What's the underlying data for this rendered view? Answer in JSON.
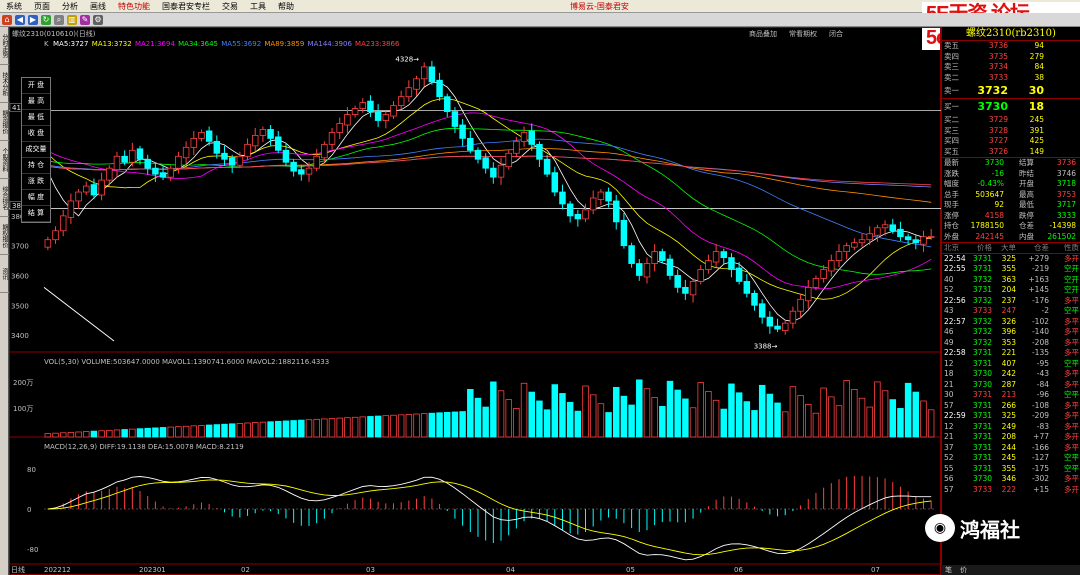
{
  "menubar": {
    "items": [
      "系统",
      "页面",
      "分析",
      "画线",
      "特色功能",
      "国泰君安专栏",
      "交易",
      "工具",
      "帮助"
    ],
    "active_index": 4,
    "window_title": "博易云-国泰君安"
  },
  "watermark": "5E天资 论坛 5etz.com",
  "left_tabs": [
    "分时走势",
    "技术分析",
    "期货报价",
    "个股资料",
    "综合排名",
    "期权报价",
    "资讯"
  ],
  "chart": {
    "title": "螺纹2310(010610)(日线)",
    "toplinks": [
      "商品叠加",
      "常看期权",
      "闭合"
    ],
    "ma_label_prefix": "K",
    "ma": [
      {
        "label": "MA5:3727",
        "color": "#ffffff"
      },
      {
        "label": "MA13:3732",
        "color": "#ffff00"
      },
      {
        "label": "MA21:3694",
        "color": "#ff00ff"
      },
      {
        "label": "MA34:3645",
        "color": "#00ff00"
      },
      {
        "label": "MA55:3692",
        "color": "#4080ff"
      },
      {
        "label": "MA89:3859",
        "color": "#ff8c00"
      },
      {
        "label": "MA144:3906",
        "color": "#8080ff"
      },
      {
        "label": "MA233:3866",
        "color": "#ff4040"
      }
    ],
    "price_axis": [
      "3800",
      "3700",
      "3600",
      "3500",
      "3400"
    ],
    "hline_labels": [
      "4154",
      "3825"
    ],
    "high_mark": "4328",
    "low_mark": "3388",
    "vol_label": "VOL(5,30) VOLUME:503647.0000 MAVOL1:1390741.6000 MAVOL2:1882116.4333",
    "vol_axis": [
      "200万",
      "100万"
    ],
    "macd_label": "MACD(12,26,9) DIFF:19.1138 DEA:15.0078 MACD:8.2119",
    "macd_axis": [
      "80",
      "0",
      "-80"
    ],
    "date_axis": [
      "日线",
      "202212",
      "202301",
      "02",
      "03",
      "04",
      "05",
      "06",
      "07"
    ],
    "sidepanel": [
      "开 盘",
      "最 高",
      "最 低",
      "收 盘",
      "成交量",
      "持 仓",
      "涨 跌",
      "幅 度",
      "结 算"
    ]
  },
  "chart_data": {
    "type": "candlestick",
    "title": "螺纹2310(010610)(日线)",
    "ylim": [
      3370,
      4360
    ],
    "high": 4328,
    "low": 3388,
    "closes": [
      3720,
      3750,
      3800,
      3850,
      3880,
      3900,
      3870,
      3920,
      3960,
      4000,
      3980,
      4020,
      3990,
      3960,
      3940,
      3930,
      3960,
      4000,
      4030,
      4060,
      4080,
      4050,
      4010,
      3990,
      3970,
      4000,
      4040,
      4070,
      4090,
      4060,
      4020,
      3980,
      3950,
      3940,
      3960,
      4000,
      4040,
      4080,
      4110,
      4140,
      4160,
      4180,
      4150,
      4120,
      4140,
      4170,
      4200,
      4230,
      4260,
      4300,
      4250,
      4200,
      4150,
      4100,
      4060,
      4020,
      3990,
      3960,
      3930,
      3970,
      4010,
      4050,
      4080,
      4040,
      3990,
      3940,
      3880,
      3840,
      3800,
      3790,
      3820,
      3860,
      3880,
      3850,
      3780,
      3700,
      3640,
      3600,
      3640,
      3680,
      3650,
      3600,
      3560,
      3540,
      3580,
      3620,
      3650,
      3680,
      3660,
      3620,
      3580,
      3540,
      3500,
      3460,
      3430,
      3420,
      3440,
      3480,
      3520,
      3560,
      3590,
      3620,
      3650,
      3680,
      3700,
      3710,
      3720,
      3740,
      3760,
      3770,
      3750,
      3730,
      3720,
      3710,
      3730,
      3731
    ],
    "volume_max_label": "200万",
    "macd": {
      "diff": 19.1138,
      "dea": 15.0078,
      "macd": 8.2119
    }
  },
  "quote": {
    "header": "螺纹2310(rb2310)",
    "asks": [
      {
        "label": "卖五",
        "price": "3736",
        "vol": "94"
      },
      {
        "label": "卖四",
        "price": "3735",
        "vol": "279"
      },
      {
        "label": "卖三",
        "price": "3734",
        "vol": "84"
      },
      {
        "label": "卖二",
        "price": "3733",
        "vol": "38"
      }
    ],
    "ask1": {
      "label": "卖一",
      "price": "3732",
      "vol": "30"
    },
    "bid1": {
      "label": "买一",
      "price": "3730",
      "vol": "18"
    },
    "bids": [
      {
        "label": "买二",
        "price": "3729",
        "vol": "245"
      },
      {
        "label": "买三",
        "price": "3728",
        "vol": "391"
      },
      {
        "label": "买四",
        "price": "3727",
        "vol": "425"
      },
      {
        "label": "买五",
        "price": "3726",
        "vol": "149"
      }
    ],
    "stats": [
      {
        "l1": "最新",
        "v1": "3730",
        "l2": "结算",
        "v2": "3736",
        "c1": "#00ff00",
        "c2": "#ff4040"
      },
      {
        "l1": "涨跌",
        "v1": "-16",
        "l2": "昨结",
        "v2": "3746",
        "c1": "#00ff00",
        "c2": "#c0c0c0"
      },
      {
        "l1": "幅度",
        "v1": "-0.43%",
        "l2": "开盘",
        "v2": "3718",
        "c1": "#00ff00",
        "c2": "#00ff00"
      },
      {
        "l1": "总手",
        "v1": "503647",
        "l2": "最高",
        "v2": "3753",
        "c1": "#ffff00",
        "c2": "#ff4040"
      },
      {
        "l1": "现手",
        "v1": "92",
        "l2": "最低",
        "v2": "3717",
        "c1": "#ffff00",
        "c2": "#00ff00"
      },
      {
        "l1": "涨停",
        "v1": "4158",
        "l2": "跌停",
        "v2": "3333",
        "c1": "#ff4040",
        "c2": "#00ff00"
      },
      {
        "l1": "持仓",
        "v1": "1788150",
        "l2": "仓差",
        "v2": "-14398",
        "c1": "#ffff00",
        "c2": "#ffff00"
      },
      {
        "l1": "外盘",
        "v1": "242145",
        "l2": "内盘",
        "v2": "261502",
        "c1": "#ff4040",
        "c2": "#00ff00"
      }
    ],
    "tick_header": [
      "北京",
      "价格",
      "大单",
      "仓差",
      "性质"
    ],
    "ticks": [
      {
        "t": "22:54",
        "p": "3731",
        "v": "325",
        "d": "+279",
        "n": "多开",
        "pc": "#00ff00",
        "nc": "#ff4040"
      },
      {
        "t": "22:55",
        "p": "3731",
        "v": "355",
        "d": "-219",
        "n": "空开",
        "pc": "#00ff00",
        "nc": "#00ff00"
      },
      {
        "t": "40",
        "p": "3732",
        "v": "363",
        "d": "+163",
        "n": "空开",
        "pc": "#00ff00",
        "nc": "#00ff00"
      },
      {
        "t": "52",
        "p": "3731",
        "v": "204",
        "d": "+145",
        "n": "空开",
        "pc": "#00ff00",
        "nc": "#00ff00"
      },
      {
        "t": "22:56",
        "p": "3732",
        "v": "237",
        "d": "-176",
        "n": "多平",
        "pc": "#00ff00",
        "nc": "#ff4040"
      },
      {
        "t": "43",
        "p": "3733",
        "v": "247",
        "d": "-2",
        "n": "空平",
        "pc": "#ff4040",
        "nc": "#00ff00"
      },
      {
        "t": "22:57",
        "p": "3732",
        "v": "326",
        "d": "-102",
        "n": "多平",
        "pc": "#00ff00",
        "nc": "#ff4040"
      },
      {
        "t": "46",
        "p": "3732",
        "v": "396",
        "d": "-140",
        "n": "多平",
        "pc": "#00ff00",
        "nc": "#ff4040"
      },
      {
        "t": "49",
        "p": "3732",
        "v": "353",
        "d": "-208",
        "n": "多平",
        "pc": "#00ff00",
        "nc": "#ff4040"
      },
      {
        "t": "22:58",
        "p": "3731",
        "v": "221",
        "d": "-135",
        "n": "多平",
        "pc": "#00ff00",
        "nc": "#ff4040"
      },
      {
        "t": "12",
        "p": "3731",
        "v": "407",
        "d": "-95",
        "n": "空平",
        "pc": "#00ff00",
        "nc": "#00ff00"
      },
      {
        "t": "18",
        "p": "3730",
        "v": "242",
        "d": "-43",
        "n": "多平",
        "pc": "#00ff00",
        "nc": "#ff4040"
      },
      {
        "t": "21",
        "p": "3730",
        "v": "287",
        "d": "-84",
        "n": "多平",
        "pc": "#00ff00",
        "nc": "#ff4040"
      },
      {
        "t": "30",
        "p": "3731",
        "v": "213",
        "d": "-96",
        "n": "空平",
        "pc": "#ff4040",
        "nc": "#00ff00"
      },
      {
        "t": "57",
        "p": "3731",
        "v": "266",
        "d": "-108",
        "n": "多平",
        "pc": "#00ff00",
        "nc": "#ff4040"
      },
      {
        "t": "22:59",
        "p": "3731",
        "v": "325",
        "d": "-209",
        "n": "多平",
        "pc": "#00ff00",
        "nc": "#ff4040"
      },
      {
        "t": "12",
        "p": "3731",
        "v": "249",
        "d": "-83",
        "n": "多平",
        "pc": "#00ff00",
        "nc": "#ff4040"
      },
      {
        "t": "21",
        "p": "3731",
        "v": "208",
        "d": "+77",
        "n": "多开",
        "pc": "#00ff00",
        "nc": "#ff4040"
      },
      {
        "t": "37",
        "p": "3731",
        "v": "244",
        "d": "-166",
        "n": "多平",
        "pc": "#00ff00",
        "nc": "#ff4040"
      },
      {
        "t": "52",
        "p": "3731",
        "v": "245",
        "d": "-127",
        "n": "空平",
        "pc": "#00ff00",
        "nc": "#00ff00"
      },
      {
        "t": "55",
        "p": "3731",
        "v": "355",
        "d": "-175",
        "n": "空平",
        "pc": "#00ff00",
        "nc": "#00ff00"
      },
      {
        "t": "56",
        "p": "3730",
        "v": "346",
        "d": "-302",
        "n": "多平",
        "pc": "#00ff00",
        "nc": "#ff4040"
      },
      {
        "t": "57",
        "p": "3733",
        "v": "222",
        "d": "+15",
        "n": "多开",
        "pc": "#ff4040",
        "nc": "#ff4040"
      }
    ],
    "bottom_tabs": [
      "笔",
      "价"
    ]
  },
  "logo": "鸿福社"
}
